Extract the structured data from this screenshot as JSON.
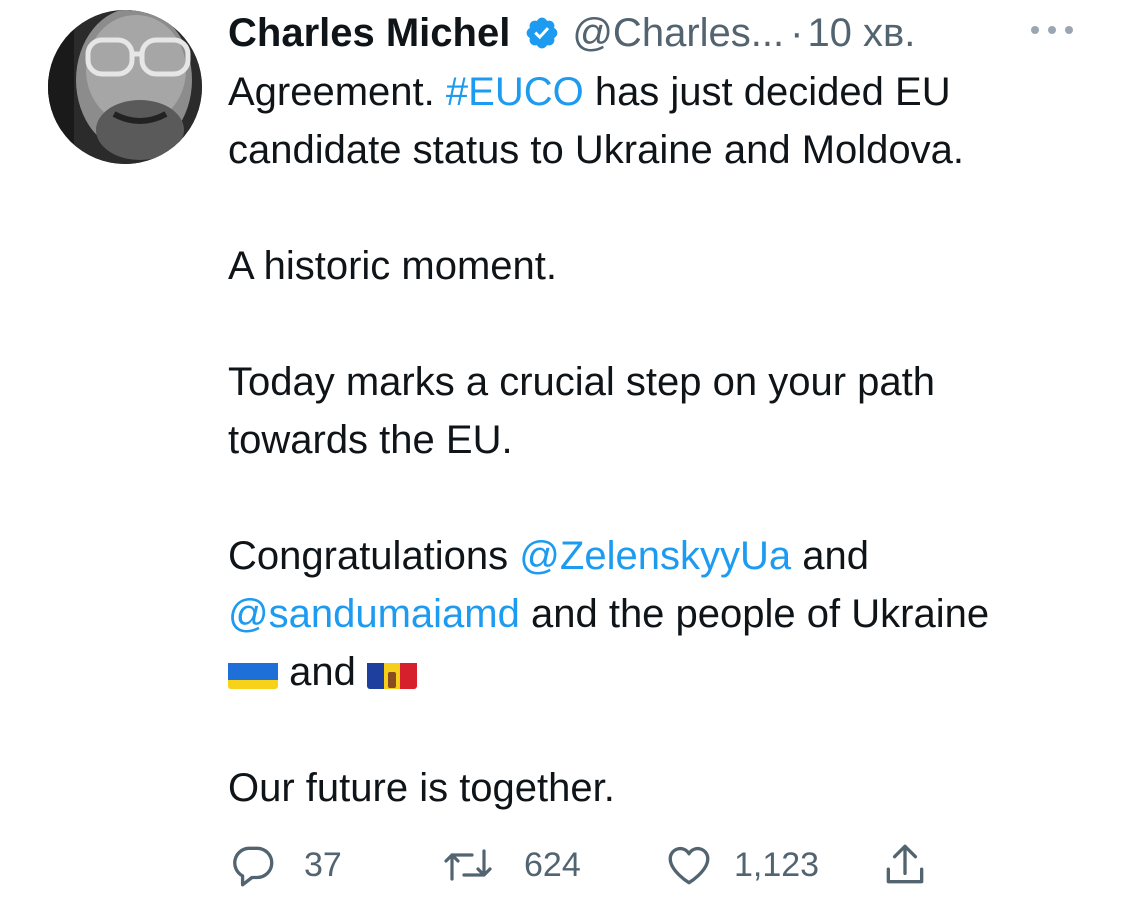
{
  "tweet": {
    "author_name": "Charles Michel",
    "handle": "@Charles...",
    "separator": "·",
    "time": "10 хв.",
    "body": {
      "line1_pre": "Agreement. ",
      "hashtag": "#EUCO",
      "line1_post": " has just decided EU",
      "line2": "candidate status to Ukraine and Moldova.",
      "line3": "A historic moment.",
      "line4": "Today marks a crucial step on your path",
      "line5": "towards the EU.",
      "line6_pre": "Congratulations ",
      "mention1": "@ZelenskyyUa",
      "line6_post": " and",
      "mention2": "@sandumaiamd",
      "line7_post": " and the people of Ukraine",
      "flags_and": " and ",
      "line9": "Our future is together."
    },
    "stats": {
      "replies": "37",
      "retweets": "624",
      "likes": "1,123"
    },
    "colors": {
      "link": "#1d9bf0",
      "verified_badge": "#1d9bf0",
      "muted": "#536471",
      "text": "#0f1419"
    },
    "icons": {
      "verified": "verified-badge-icon",
      "more": "more-dots-icon",
      "reply": "reply-icon",
      "retweet": "retweet-icon",
      "like": "heart-icon",
      "share": "share-icon",
      "flag_ukraine": "flag-ukraine-icon",
      "flag_moldova": "flag-moldova-icon"
    }
  }
}
